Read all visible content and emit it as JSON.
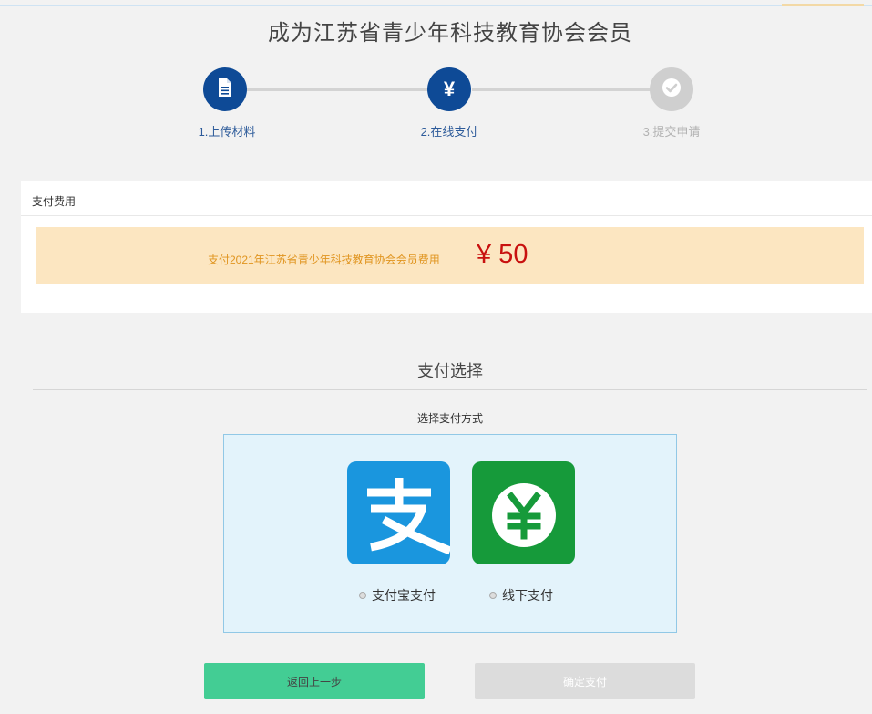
{
  "page": {
    "title": "成为江苏省青少年科技教育协会会员"
  },
  "steps": [
    {
      "label": "1.上传材料",
      "state": "done",
      "icon": "document-icon"
    },
    {
      "label": "2.在线支付",
      "state": "current",
      "icon": "yen-icon",
      "glyph": "¥"
    },
    {
      "label": "3.提交申请",
      "state": "todo",
      "icon": "check-icon"
    }
  ],
  "fee": {
    "header": "支付费用",
    "description": "支付2021年江苏省青少年科技教育协会会员费用",
    "amount": "¥ 50"
  },
  "payment": {
    "title": "支付选择",
    "subtitle": "选择支付方式",
    "options": [
      {
        "label": "支付宝支付",
        "icon": "alipay-icon",
        "color": "#1a96de"
      },
      {
        "label": "线下支付",
        "icon": "cash-yen-icon",
        "color": "#169a3a"
      }
    ]
  },
  "buttons": {
    "back": "返回上一步",
    "confirm": "确定支付"
  },
  "colors": {
    "primary": "#0e4a96",
    "back_button": "#43cd94",
    "amount": "#c8110f",
    "fee_bar": "#fce6c1"
  }
}
